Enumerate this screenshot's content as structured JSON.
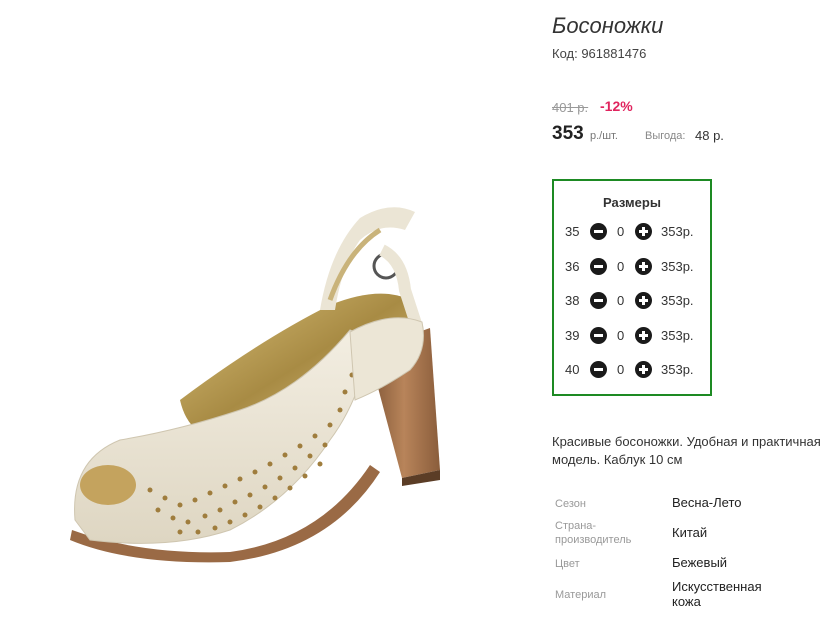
{
  "product": {
    "title": "Босоножки",
    "code": "Код: 961881476"
  },
  "price": {
    "old": "401 р.",
    "discount": "-12%",
    "current": "353",
    "unit": "р./шт.",
    "saving_label": "Выгода:",
    "saving_value": "48 р."
  },
  "sizes": {
    "title": "Размеры",
    "rows": [
      {
        "size": "35",
        "qty": "0",
        "price": "353р."
      },
      {
        "size": "36",
        "qty": "0",
        "price": "353р."
      },
      {
        "size": "38",
        "qty": "0",
        "price": "353р."
      },
      {
        "size": "39",
        "qty": "0",
        "price": "353р."
      },
      {
        "size": "40",
        "qty": "0",
        "price": "353р."
      }
    ]
  },
  "description": "Красивые босоножки. Удобная и практичная модель. Каблук 10 см",
  "attributes": [
    {
      "label": "Сезон",
      "value": "Весна-Лето"
    },
    {
      "label": "Страна-производитель",
      "value": "Китай"
    },
    {
      "label": "Цвет",
      "value": "Бежевый"
    },
    {
      "label": "Материал",
      "value": "Искусственная кожа"
    }
  ],
  "colors": {
    "border_green": "#1d8a23",
    "discount_pink": "#e0245e",
    "shoe": "#ece6d6",
    "heel": "#a8744a"
  }
}
